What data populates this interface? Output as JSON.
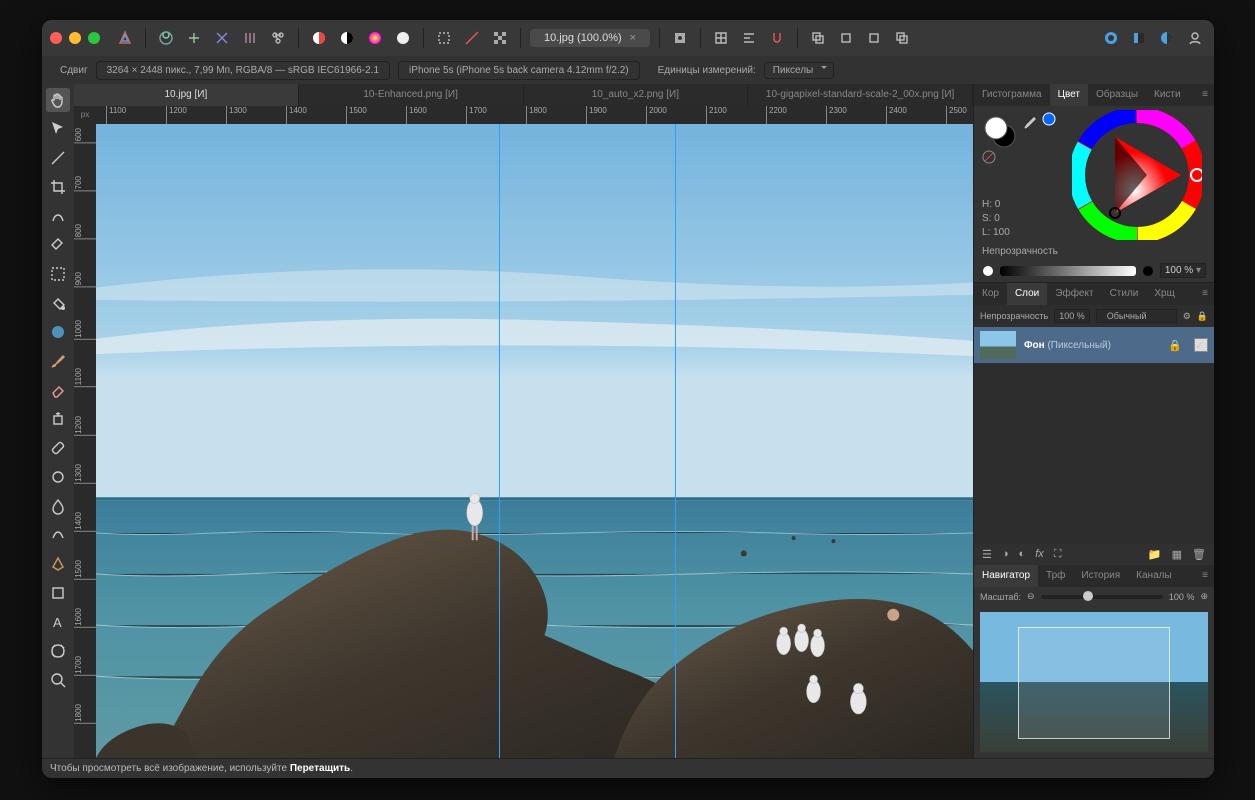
{
  "info": {
    "shift": "Сдвиг",
    "dims": "3264 × 2448 пикс., 7,99 Мп, RGBA/8 — sRGB IEC61966-2.1",
    "camera": "iPhone 5s (iPhone 5s back camera 4.12mm f/2.2)",
    "units_label": "Единицы измерений:",
    "units_value": "Пикселы"
  },
  "file": {
    "name": "10.jpg (100.0%)"
  },
  "doctabs": [
    "10.jpg [И]",
    "10-Enhanced.png [И]",
    "10_auto_x2.png [И]",
    "10-gigapixel-standard-scale-2_00x.png [И]"
  ],
  "doctab_active": 0,
  "hruler": [
    "1100",
    "1200",
    "1300",
    "1400",
    "1500",
    "1600",
    "1700",
    "1800",
    "1900",
    "2000",
    "2100",
    "2200",
    "2300",
    "2400",
    "2500"
  ],
  "vruler": [
    "600",
    "700",
    "800",
    "900",
    "1000",
    "1100",
    "1200",
    "1300",
    "1400",
    "1500",
    "1600",
    "1700",
    "1800"
  ],
  "px_label": "px",
  "color_tabs": [
    "Гистограмма",
    "Цвет",
    "Образцы",
    "Кисти"
  ],
  "color_tab_active": 1,
  "hsl": {
    "h": "H: 0",
    "s": "S: 0",
    "l": "L: 100",
    "opacity_label": "Непрозрачность",
    "opacity_value": "100 %"
  },
  "layer_tabs": [
    "Кор",
    "Слои",
    "Эффект",
    "Стили",
    "Хрщ"
  ],
  "layer_tab_active": 1,
  "layer_opac": {
    "label": "Непрозрачность",
    "value": "100 %",
    "blend": "Обычный"
  },
  "layer": {
    "name": "Фон",
    "kind": "(Пиксельный)"
  },
  "nav_tabs": [
    "Навигатор",
    "Трф",
    "История",
    "Каналы"
  ],
  "nav_tab_active": 0,
  "zoom": {
    "label": "Масштаб:",
    "value": "100 %"
  },
  "footer": {
    "prefix": "Чтобы просмотреть всё изображение, используйте ",
    "bold": "Перетащить",
    "suffix": "."
  }
}
